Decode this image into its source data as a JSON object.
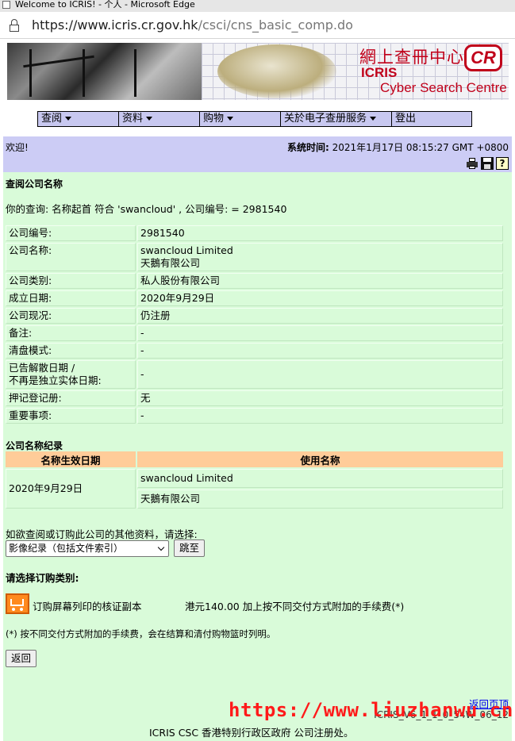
{
  "browser": {
    "window_title": "Welcome to ICRIS! - 个人 - Microsoft Edge",
    "url_host": "https://www.icris.cr.gov.hk",
    "url_path": "/csci/cns_basic_comp.do"
  },
  "banner": {
    "cn_title": "網上查冊中心",
    "icris": "ICRIS",
    "subtitle": "Cyber Search Centre",
    "logo": "CR"
  },
  "menu": {
    "items": [
      {
        "label": "查阅"
      },
      {
        "label": "资料"
      },
      {
        "label": "购物"
      },
      {
        "label": "关於电子查册服务"
      },
      {
        "label": "登出"
      }
    ]
  },
  "welcome": {
    "greeting": "欢迎!",
    "time_label": "系统时间:",
    "time_value": "2021年1月17日 08:15:27 GMT +0800",
    "tool_icons": [
      "printer-icon",
      "floppy-disk-icon",
      "help-icon"
    ],
    "help_glyph": "?"
  },
  "search": {
    "section_title": "查阅公司名称",
    "query_text": "你的查询:  名称起首 符合 'swancloud' , 公司编号:  = 2981540"
  },
  "company": {
    "rows": [
      {
        "label": "公司编号:",
        "value": "2981540"
      },
      {
        "label": "公司名称:",
        "value": "swancloud Limited",
        "value2": "天鵝有限公司"
      },
      {
        "label": "公司类别:",
        "value": "私人股份有限公司"
      },
      {
        "label": "成立日期:",
        "value": "2020年9月29日"
      },
      {
        "label": "公司现况:",
        "value": "仍注册"
      },
      {
        "label": "备注:",
        "value": "-"
      },
      {
        "label": "清盘模式:",
        "value": "-"
      },
      {
        "label": "已告解散日期 /",
        "label2": "不再是独立实体日期:",
        "value": "-"
      },
      {
        "label": "押记登记册:",
        "value": "无"
      },
      {
        "label": "重要事项:",
        "value": "-"
      }
    ]
  },
  "name_history": {
    "title": "公司名称纪录",
    "headers": [
      "名称生效日期",
      "使用名称"
    ],
    "effective_date": "2020年9月29日",
    "names": [
      "swancloud Limited",
      "天鵝有限公司"
    ]
  },
  "other_info": {
    "prompt": "如欲查阅或订购此公司的其他资料，请选择:",
    "selected": "影像纪录（包括文件索引）",
    "go_label": "跳至"
  },
  "order": {
    "title": "请选择订购类别:",
    "item": "订购屏幕列印的核证副本",
    "price": "港元140.00 加上按不同交付方式附加的手续费(*)",
    "footnote": "(*) 按不同交付方式附加的手续费，会在结算和清付购物篮时列明。",
    "back_label": "返回"
  },
  "footer": {
    "home_link": "返回页顶",
    "version": "ICRIS_V6_1_1_0_54W_06_12",
    "watermark": "https://www.liuzhanwu.cn",
    "text": "ICRIS CSC 香港特别行政区政府 公司注册处。"
  },
  "colors": {
    "menu_bg": "#c8c8f0",
    "welcome_bg": "#ccccf5",
    "content_bg": "#d9fbd9",
    "table_header_bg": "#ffcc99",
    "brand_red": "#c0001a",
    "watermark_red": "#ff1a1a",
    "link_blue": "#0000ee"
  }
}
